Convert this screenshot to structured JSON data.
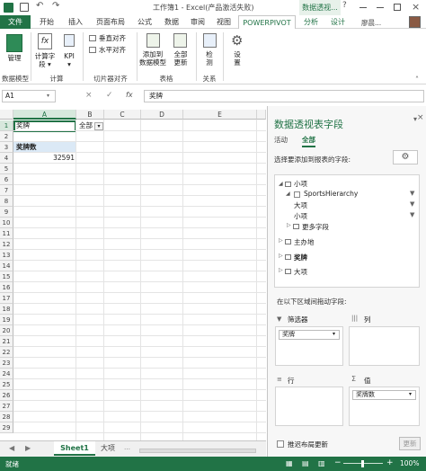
{
  "titlebar": {
    "title": "工作簿1 - Excel(产品激活失败)",
    "context_tab": "数据透视...",
    "user": "廖晨..."
  },
  "tabs": [
    "文件",
    "开始",
    "插入",
    "页面布局",
    "公式",
    "数据",
    "审阅",
    "视图",
    "POWERPIVOT",
    "分析",
    "设计"
  ],
  "ribbon": {
    "manage": "管理",
    "calc_fields": "计算字\n段 ▾",
    "kpi": "KPI\n▾",
    "vertical_align": "垂直对齐",
    "horizontal_align": "水平对齐",
    "add_to_model": "添加到\n数据模型",
    "update_all": "全部\n更新",
    "detect": "检\n测",
    "settings": "设\n置",
    "groups": [
      "数据模型",
      "计算",
      "切片器对齐",
      "表格",
      "关系"
    ]
  },
  "formula": {
    "namebox": "A1",
    "fx": "fx",
    "value": "奖牌"
  },
  "grid": {
    "columns": [
      "A",
      "B",
      "C",
      "D",
      "E"
    ],
    "rows": [
      "1",
      "2",
      "3",
      "4",
      "5",
      "6",
      "7",
      "8",
      "9",
      "10",
      "11",
      "12",
      "13",
      "14",
      "15",
      "16",
      "17",
      "18",
      "19",
      "20",
      "21",
      "22",
      "23",
      "24",
      "25",
      "26",
      "27",
      "28",
      "29"
    ],
    "a1": "奖牌",
    "b1": "全部",
    "a3": "奖牌数",
    "a4": "32591"
  },
  "sheettabs": {
    "active": "Sheet1",
    "other": "大项"
  },
  "status": {
    "ready": "就绪",
    "zoom": "100%"
  },
  "pane": {
    "title": "数据透视表字段",
    "tab_active": "活动",
    "tab_all": "全部",
    "choose_label": "选择要添加到报表的字段:",
    "fields": [
      "小项",
      "SportsHierarchy",
      "大项",
      "小项",
      "更多字段",
      "主办地",
      "奖牌",
      "大项"
    ],
    "drag_label": "在以下区域间拖动字段:",
    "area_filter": "筛选器",
    "area_columns": "列",
    "area_rows": "行",
    "area_values": "值",
    "filter_item": "奖牌",
    "values_item": "奖牌数",
    "defer": "推迟布局更新",
    "update_btn": "更新"
  }
}
